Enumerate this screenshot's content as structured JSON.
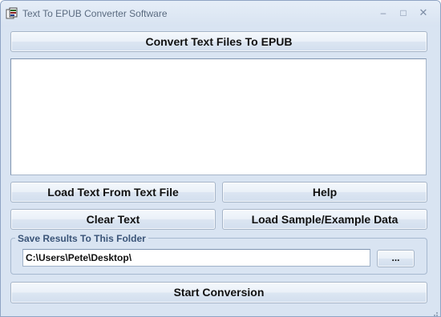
{
  "window": {
    "title": "Text To EPUB Converter Software",
    "controls": {
      "minimize": "–",
      "maximize": "□",
      "close": "✕"
    }
  },
  "buttons": {
    "convert_header": "Convert Text Files To EPUB",
    "load_text": "Load Text From Text File",
    "help": "Help",
    "clear_text": "Clear Text",
    "load_sample": "Load Sample/Example Data",
    "browse": "...",
    "start": "Start Conversion"
  },
  "text_area": {
    "value": ""
  },
  "save_group": {
    "label": "Save Results To This Folder",
    "path_value": "C:\\Users\\Pete\\Desktop\\"
  },
  "colors": {
    "window_bg": "#d9e4f2",
    "title_text": "#5a6b80",
    "group_label": "#3a5478"
  },
  "icons": {
    "app": "app-icon",
    "minimize": "minimize-icon",
    "maximize": "maximize-icon",
    "close": "close-icon"
  }
}
